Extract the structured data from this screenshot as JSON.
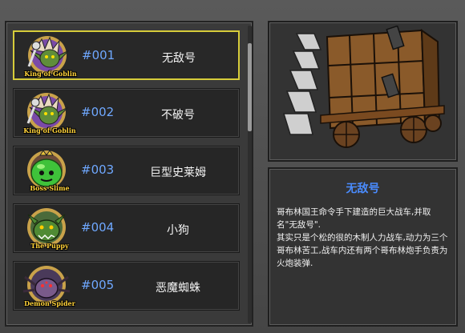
{
  "list": {
    "items": [
      {
        "portrait_label": "King of Goblin",
        "number": "#001",
        "name": "无敌号",
        "selected": true
      },
      {
        "portrait_label": "King of Goblin",
        "number": "#002",
        "name": "不破号",
        "selected": false
      },
      {
        "portrait_label": "Boss Slime",
        "number": "#003",
        "name": "巨型史莱姆",
        "selected": false
      },
      {
        "portrait_label": "The Puppy",
        "number": "#004",
        "name": "小狗",
        "selected": false
      },
      {
        "portrait_label": "Demon Spider",
        "number": "#005",
        "name": "恶魔蜘蛛",
        "selected": false
      }
    ]
  },
  "detail": {
    "title": "无敌号",
    "description_line1": "哥布林国王命令手下建造的巨大战车,并取名\"无敌号\".",
    "description_line2": "其实只是个松的很的木制人力战车,动力为三个哥布林苦工,战车内还有两个哥布林炮手负责为火炮装弹."
  },
  "colors": {
    "accent_selected": "#d6cc3a",
    "number_blue": "#6fa8ff",
    "title_blue": "#4a8cff",
    "label_gold": "#ffd23a"
  },
  "icons": [
    "goblin-king-portrait-icon",
    "boss-slime-portrait-icon",
    "puppy-portrait-icon",
    "demon-spider-portrait-icon",
    "war-cart-illustration"
  ]
}
